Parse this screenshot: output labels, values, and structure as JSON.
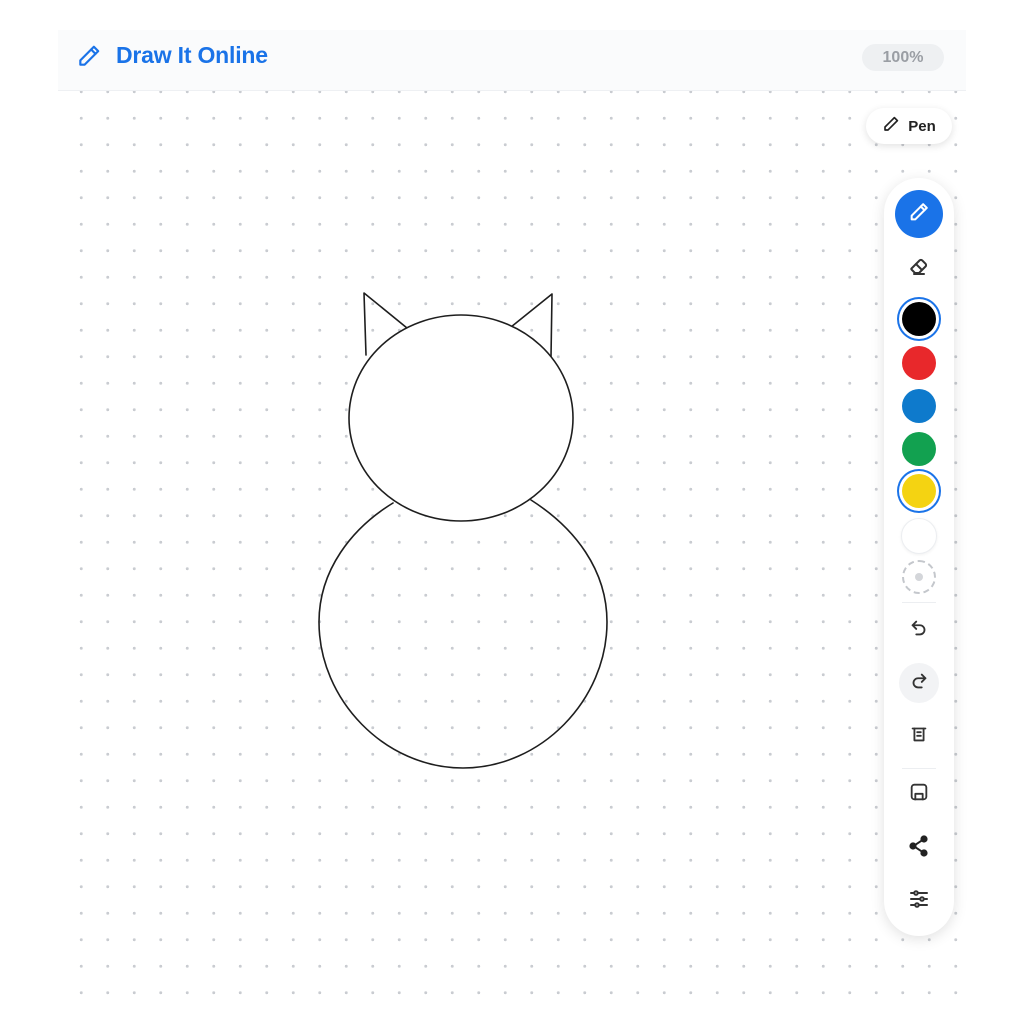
{
  "header": {
    "title": "Draw It Online",
    "title_color": "#1a73e8",
    "brand_icon": "pencil-icon",
    "zoom_label": "100%"
  },
  "tool_chip": {
    "icon": "pencil-icon",
    "label": "Pen"
  },
  "toolbar": {
    "active_tool": "pen",
    "tools": [
      {
        "id": "pen",
        "icon": "pencil-icon",
        "active": true
      },
      {
        "id": "eraser",
        "icon": "eraser-icon",
        "active": false
      }
    ],
    "colors": [
      {
        "name": "black",
        "hex": "#000000",
        "selected": true
      },
      {
        "name": "red",
        "hex": "#e8282b",
        "selected": false
      },
      {
        "name": "blue",
        "hex": "#0e7acc",
        "selected": false
      },
      {
        "name": "green",
        "hex": "#12a150",
        "selected": false
      },
      {
        "name": "yellow",
        "hex": "#f4d312",
        "selected": true
      },
      {
        "name": "white",
        "hex": "#ffffff",
        "selected": false
      }
    ],
    "actions": [
      {
        "id": "custom-color",
        "icon": "custom-color-icon"
      },
      {
        "id": "undo",
        "icon": "undo-icon"
      },
      {
        "id": "redo",
        "icon": "redo-icon"
      },
      {
        "id": "clear",
        "icon": "trash-icon"
      },
      {
        "id": "save",
        "icon": "save-icon"
      },
      {
        "id": "share",
        "icon": "share-icon"
      },
      {
        "id": "settings",
        "icon": "sliders-icon"
      }
    ]
  }
}
